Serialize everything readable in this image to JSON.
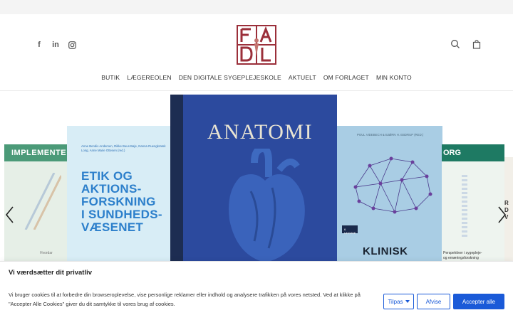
{
  "header": {
    "social": [
      {
        "icon": "facebook-icon",
        "glyph": "f"
      },
      {
        "icon": "linkedin-icon",
        "glyph": "in"
      },
      {
        "icon": "instagram-icon",
        "glyph": ""
      }
    ],
    "logo_color": "#9b2f3a"
  },
  "nav": {
    "items": [
      "BUTIK",
      "LÆGEREOLEN",
      "DEN DIGITALE SYGEPLEJESKOLE",
      "AKTUELT",
      "OM FORLAGET",
      "MIN KONTO"
    ]
  },
  "slider": {
    "book1": {
      "title": "IMPLEMENTE",
      "snippet": "Hvordar"
    },
    "book2": {
      "authors": "Anne Bendix Andersen, Rikke Buus Bøje, Nanna Ruengkratok Long, Anne Marie Ottesen (red.)",
      "title_lines": [
        "ETIK OG",
        "AKTIONS-",
        "FORSKNING",
        "I SUNDHEDS-",
        "VÆSENET"
      ]
    },
    "book3": {
      "title": "ANATOMI"
    },
    "book4": {
      "authors": "POUL VIDEBECH & BJØRN H. EBDRUP (RED.)",
      "badge": "6. UDGAVE",
      "title": "KLINISK"
    },
    "book5": {
      "title": "ORG",
      "subtitle_lines": [
        "Perspektiver i sygepleje-",
        "og ernæringsforskning"
      ]
    },
    "book6": {
      "letters": [
        "R",
        "D",
        "V"
      ]
    }
  },
  "cookie": {
    "heading": "Vi værdsætter dit privatliv",
    "text": "Vi bruger cookies til at forbedre din browseroplevelse, vise personlige reklamer eller indhold og analysere trafikken på vores netsted. Ved at klikke på \"Accepter Alle Cookies\" giver du dit samtykke til vores brug af cookies.",
    "customize_label": "Tilpas",
    "reject_label": "Afvise",
    "accept_label": "Accepter alle",
    "accent": "#1a5ad8"
  }
}
